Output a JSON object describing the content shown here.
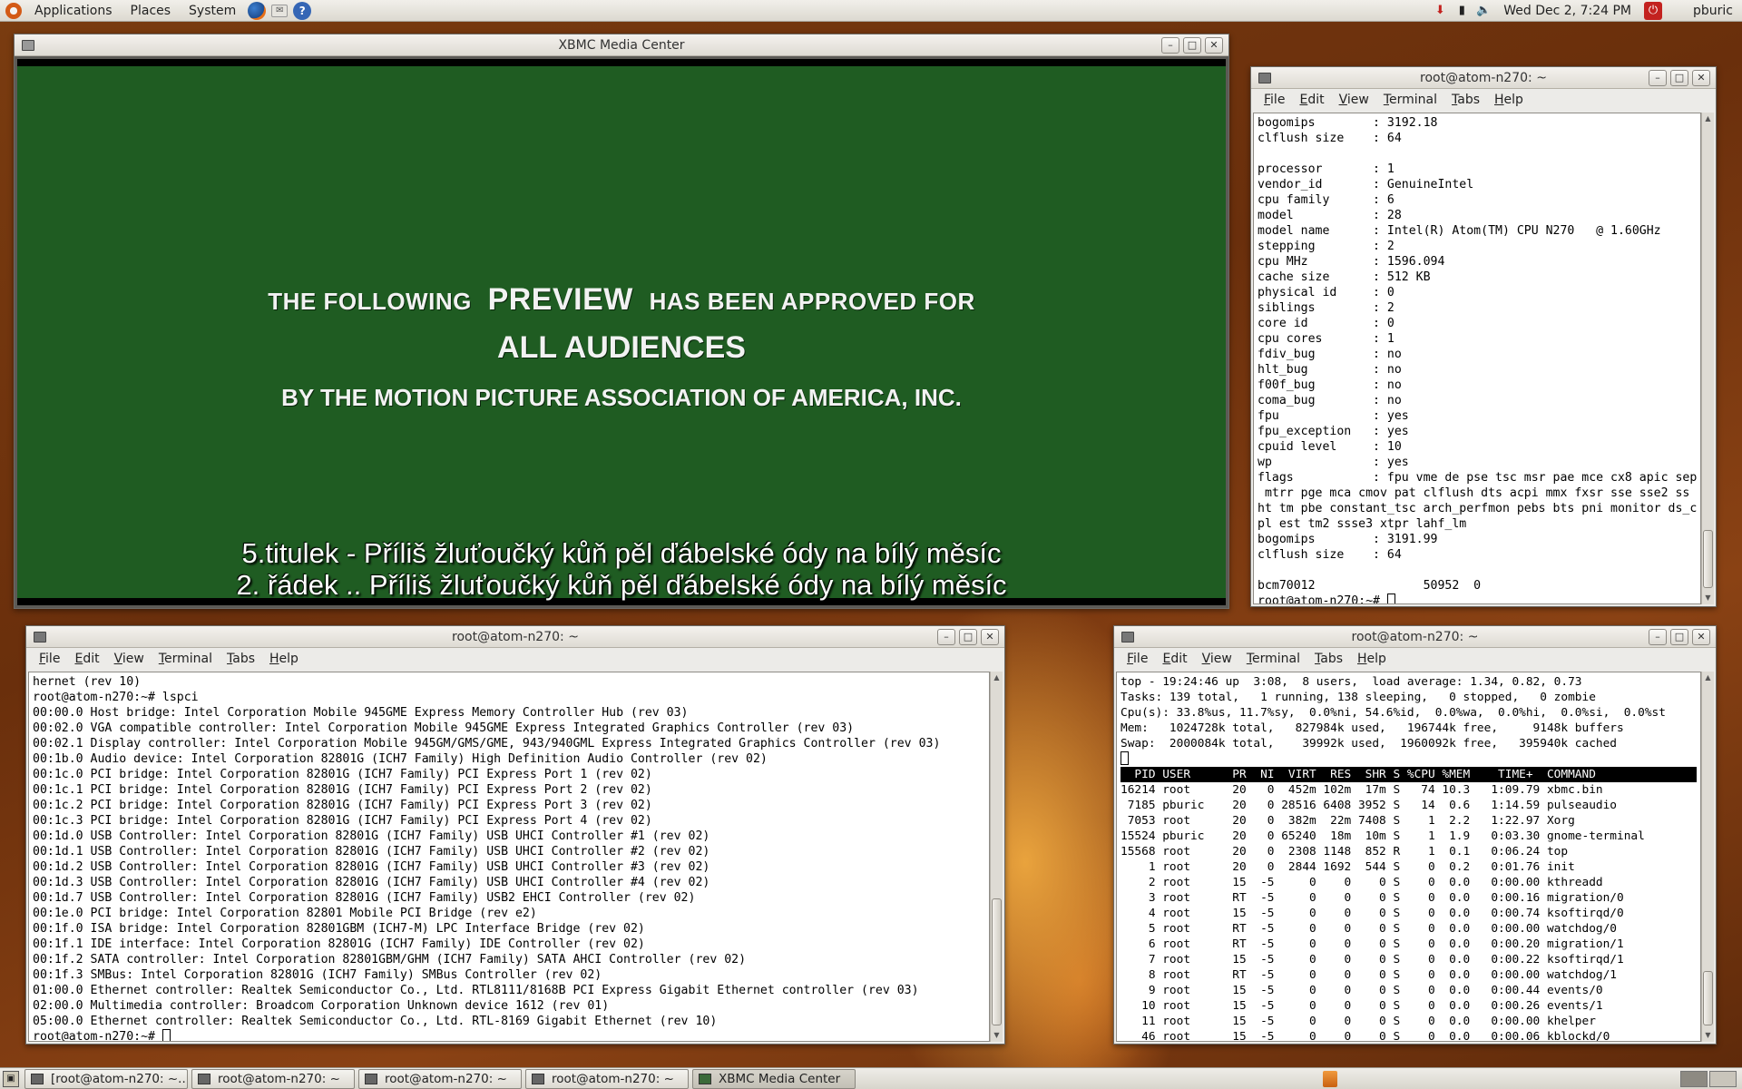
{
  "top_panel": {
    "menus": [
      "Applications",
      "Places",
      "System"
    ],
    "launchers": [
      "firefox-icon",
      "mail-icon",
      "help-icon"
    ],
    "clock": "Wed Dec  2,  7:24 PM",
    "user": "pburic"
  },
  "xbmc": {
    "title": "XBMC Media Center",
    "mpaa": {
      "line1_pre": "THE FOLLOWING",
      "line1_big": "PREVIEW",
      "line1_post": "HAS BEEN APPROVED FOR",
      "line2": "ALL AUDIENCES",
      "line3": "BY THE MOTION PICTURE ASSOCIATION OF AMERICA, INC."
    },
    "subtitles": [
      "5.titulek - Příliš žluťoučký kůň pěl ďábelské ódy na bílý měsíc",
      "2. řádek .. Příliš žluťoučký kůň pěl ďábelské ódy na bílý měsíc"
    ]
  },
  "terminal_menu": [
    "File",
    "Edit",
    "View",
    "Terminal",
    "Tabs",
    "Help"
  ],
  "cpuinfo_terminal": {
    "title": "root@atom-n270: ~",
    "lines": [
      "bogomips        : 3192.18",
      "clflush size    : 64",
      "",
      "processor       : 1",
      "vendor_id       : GenuineIntel",
      "cpu family      : 6",
      "model           : 28",
      "model name      : Intel(R) Atom(TM) CPU N270   @ 1.60GHz",
      "stepping        : 2",
      "cpu MHz         : 1596.094",
      "cache size      : 512 KB",
      "physical id     : 0",
      "siblings        : 2",
      "core id         : 0",
      "cpu cores       : 1",
      "fdiv_bug        : no",
      "hlt_bug         : no",
      "f00f_bug        : no",
      "coma_bug        : no",
      "fpu             : yes",
      "fpu_exception   : yes",
      "cpuid level     : 10",
      "wp              : yes",
      "flags           : fpu vme de pse tsc msr pae mce cx8 apic sep",
      " mtrr pge mca cmov pat clflush dts acpi mmx fxsr sse sse2 ss",
      "ht tm pbe constant_tsc arch_perfmon pebs bts pni monitor ds_c",
      "pl est tm2 ssse3 xtpr lahf_lm",
      "bogomips        : 3191.99",
      "clflush size    : 64",
      "",
      "bcm70012               50952  0"
    ],
    "prompt": "root@atom-n270:~# "
  },
  "lspci_terminal": {
    "title": "root@atom-n270: ~",
    "lines": [
      "hernet (rev 10)",
      "root@atom-n270:~# lspci",
      "00:00.0 Host bridge: Intel Corporation Mobile 945GME Express Memory Controller Hub (rev 03)",
      "00:02.0 VGA compatible controller: Intel Corporation Mobile 945GME Express Integrated Graphics Controller (rev 03)",
      "00:02.1 Display controller: Intel Corporation Mobile 945GM/GMS/GME, 943/940GML Express Integrated Graphics Controller (rev 03)",
      "00:1b.0 Audio device: Intel Corporation 82801G (ICH7 Family) High Definition Audio Controller (rev 02)",
      "00:1c.0 PCI bridge: Intel Corporation 82801G (ICH7 Family) PCI Express Port 1 (rev 02)",
      "00:1c.1 PCI bridge: Intel Corporation 82801G (ICH7 Family) PCI Express Port 2 (rev 02)",
      "00:1c.2 PCI bridge: Intel Corporation 82801G (ICH7 Family) PCI Express Port 3 (rev 02)",
      "00:1c.3 PCI bridge: Intel Corporation 82801G (ICH7 Family) PCI Express Port 4 (rev 02)",
      "00:1d.0 USB Controller: Intel Corporation 82801G (ICH7 Family) USB UHCI Controller #1 (rev 02)",
      "00:1d.1 USB Controller: Intel Corporation 82801G (ICH7 Family) USB UHCI Controller #2 (rev 02)",
      "00:1d.2 USB Controller: Intel Corporation 82801G (ICH7 Family) USB UHCI Controller #3 (rev 02)",
      "00:1d.3 USB Controller: Intel Corporation 82801G (ICH7 Family) USB UHCI Controller #4 (rev 02)",
      "00:1d.7 USB Controller: Intel Corporation 82801G (ICH7 Family) USB2 EHCI Controller (rev 02)",
      "00:1e.0 PCI bridge: Intel Corporation 82801 Mobile PCI Bridge (rev e2)",
      "00:1f.0 ISA bridge: Intel Corporation 82801GBM (ICH7-M) LPC Interface Bridge (rev 02)",
      "00:1f.1 IDE interface: Intel Corporation 82801G (ICH7 Family) IDE Controller (rev 02)",
      "00:1f.2 SATA controller: Intel Corporation 82801GBM/GHM (ICH7 Family) SATA AHCI Controller (rev 02)",
      "00:1f.3 SMBus: Intel Corporation 82801G (ICH7 Family) SMBus Controller (rev 02)",
      "01:00.0 Ethernet controller: Realtek Semiconductor Co., Ltd. RTL8111/8168B PCI Express Gigabit Ethernet controller (rev 03)",
      "02:00.0 Multimedia controller: Broadcom Corporation Unknown device 1612 (rev 01)",
      "05:00.0 Ethernet controller: Realtek Semiconductor Co., Ltd. RTL-8169 Gigabit Ethernet (rev 10)"
    ],
    "prompt": "root@atom-n270:~# "
  },
  "top_terminal": {
    "title": "root@atom-n270: ~",
    "summary": [
      "top - 19:24:46 up  3:08,  8 users,  load average: 1.34, 0.82, 0.73",
      "Tasks: 139 total,   1 running, 138 sleeping,   0 stopped,   0 zombie",
      "Cpu(s): 33.8%us, 11.7%sy,  0.0%ni, 54.6%id,  0.0%wa,  0.0%hi,  0.0%si,  0.0%st",
      "Mem:   1024728k total,   827984k used,   196744k free,     9148k buffers",
      "Swap:  2000084k total,    39992k used,  1960092k free,   395940k cached"
    ],
    "header": "  PID USER      PR  NI  VIRT  RES  SHR S %CPU %MEM    TIME+  COMMAND",
    "rows": [
      "16214 root      20   0  452m 102m  17m S   74 10.3   1:09.79 xbmc.bin",
      " 7185 pburic    20   0 28516 6408 3952 S   14  0.6   1:14.59 pulseaudio",
      " 7053 root      20   0  382m  22m 7408 S    1  2.2   1:22.97 Xorg",
      "15524 pburic    20   0 65240  18m  10m S    1  1.9   0:03.30 gnome-terminal",
      "15568 root      20   0  2308 1148  852 R    1  0.1   0:06.24 top",
      "    1 root      20   0  2844 1692  544 S    0  0.2   0:01.76 init",
      "    2 root      15  -5     0    0    0 S    0  0.0   0:00.00 kthreadd",
      "    3 root      RT  -5     0    0    0 S    0  0.0   0:00.16 migration/0",
      "    4 root      15  -5     0    0    0 S    0  0.0   0:00.74 ksoftirqd/0",
      "    5 root      RT  -5     0    0    0 S    0  0.0   0:00.00 watchdog/0",
      "    6 root      RT  -5     0    0    0 S    0  0.0   0:00.20 migration/1",
      "    7 root      15  -5     0    0    0 S    0  0.0   0:00.22 ksoftirqd/1",
      "    8 root      RT  -5     0    0    0 S    0  0.0   0:00.00 watchdog/1",
      "    9 root      15  -5     0    0    0 S    0  0.0   0:00.44 events/0",
      "   10 root      15  -5     0    0    0 S    0  0.0   0:00.26 events/1",
      "   11 root      15  -5     0    0    0 S    0  0.0   0:00.00 khelper",
      "   46 root      15  -5     0    0    0 S    0  0.0   0:00.06 kblockd/0"
    ]
  },
  "taskbar": {
    "tasks": [
      "[root@atom-n270: ~...",
      "root@atom-n270: ~",
      "root@atom-n270: ~",
      "root@atom-n270: ~",
      "XBMC Media Center"
    ]
  }
}
